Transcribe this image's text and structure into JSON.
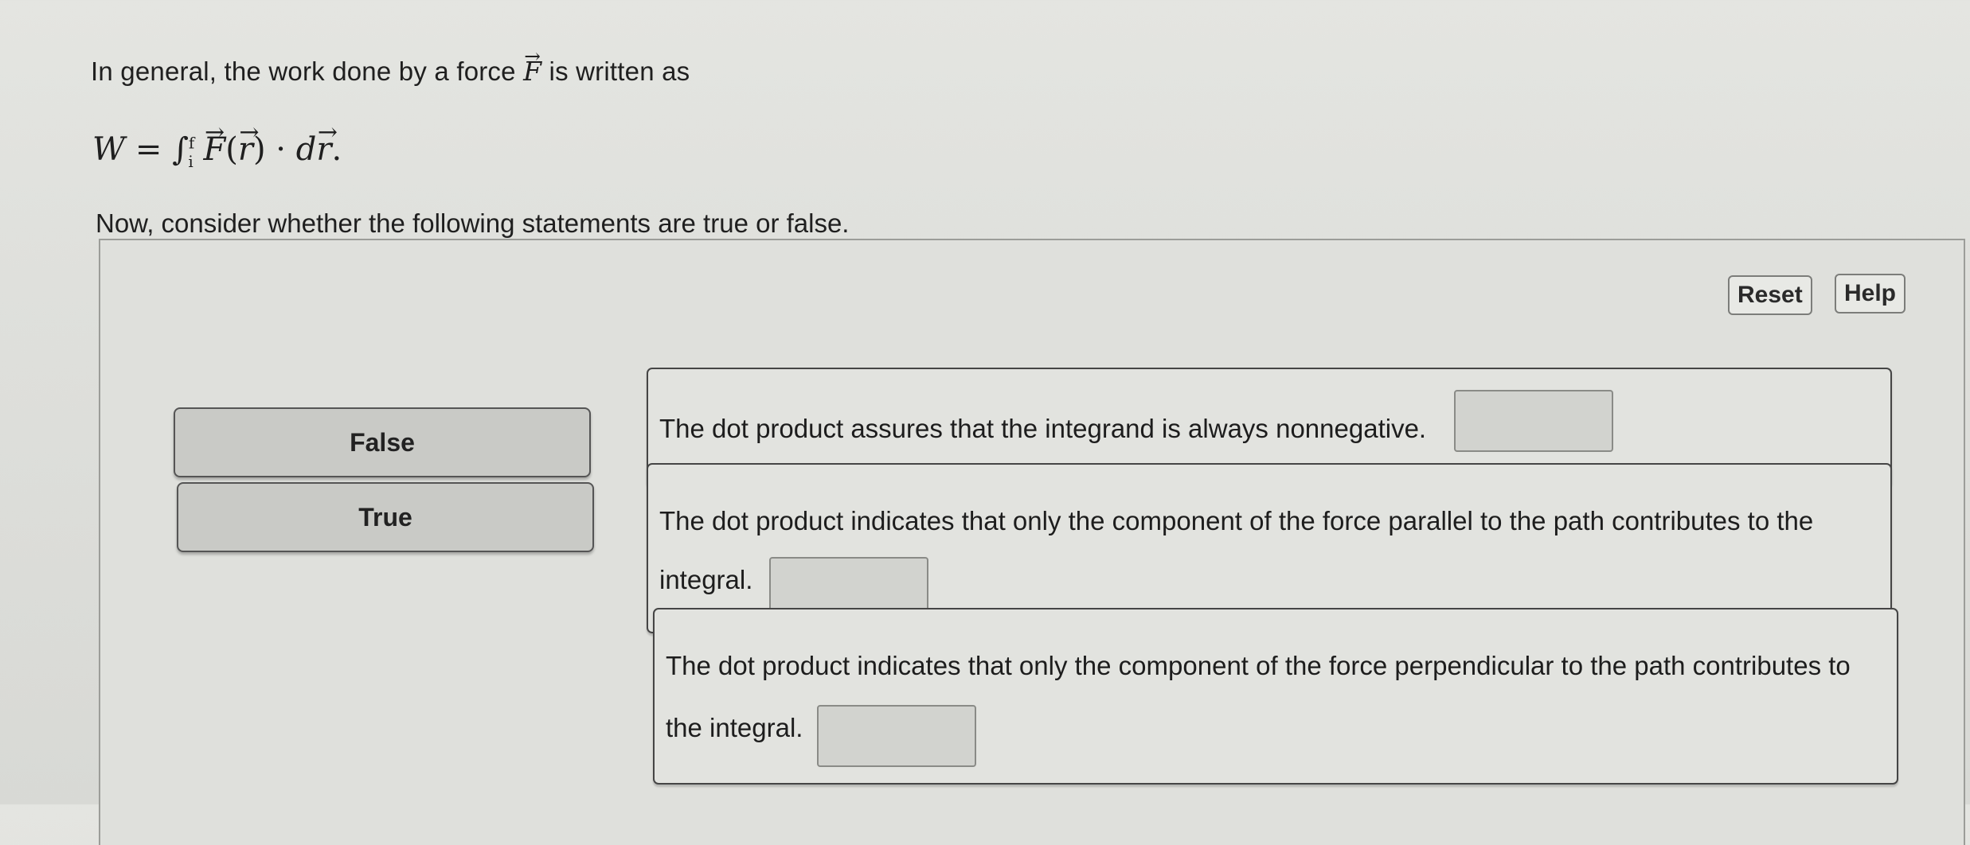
{
  "intro": {
    "prefix": "In general, the work done by a force",
    "force_symbol": "F",
    "suffix": "is written as"
  },
  "formula": {
    "lhs": "W",
    "equals": "=",
    "integral": "∫",
    "lower": "i",
    "upper": "f",
    "force": "F",
    "arg_open": "(",
    "arg": "r",
    "arg_close": ")",
    "dot": "·",
    "d": "d",
    "dr": "r",
    "period": "."
  },
  "prompt": "Now, consider whether the following statements are true or false.",
  "toolbar": {
    "reset_label": "Reset",
    "help_label": "Help"
  },
  "answers": [
    {
      "label": "False"
    },
    {
      "label": "True"
    }
  ],
  "statements": [
    {
      "line1": "The dot product assures that the integrand is always nonnegative.",
      "line2": ""
    },
    {
      "line1": "The dot product indicates that only the component of the force parallel to the path contributes to the",
      "line2": "integral."
    },
    {
      "line1": "The dot product indicates that only the component of the force perpendicular to the path contributes to",
      "line2": "the integral."
    }
  ]
}
